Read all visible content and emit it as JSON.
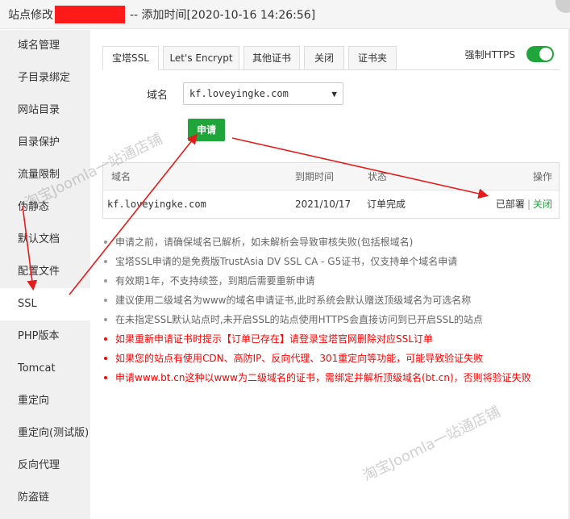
{
  "titlebar": {
    "prefix": "站点修改",
    "suffix": "-- 添加时间[2020-10-16 14:26:56]"
  },
  "sidebar": {
    "items": [
      {
        "label": "域名管理"
      },
      {
        "label": "子目录绑定"
      },
      {
        "label": "网站目录"
      },
      {
        "label": "目录保护"
      },
      {
        "label": "流量限制"
      },
      {
        "label": "伪静态"
      },
      {
        "label": "默认文档"
      },
      {
        "label": "配置文件"
      },
      {
        "label": "SSL"
      },
      {
        "label": "PHP版本"
      },
      {
        "label": "Tomcat"
      },
      {
        "label": "重定向"
      },
      {
        "label": "重定向(测试版)"
      },
      {
        "label": "反向代理"
      },
      {
        "label": "防盗链"
      }
    ]
  },
  "tabs": [
    {
      "label": "宝塔SSL"
    },
    {
      "label": "Let's Encrypt"
    },
    {
      "label": "其他证书"
    },
    {
      "label": "关闭"
    },
    {
      "label": "证书夹"
    }
  ],
  "force_https": {
    "label": "强制HTTPS",
    "enabled": true
  },
  "domain": {
    "label": "域名",
    "selected": "kf.loveyingke.com"
  },
  "apply_button": "申请",
  "table": {
    "headers": {
      "domain": "域名",
      "expire": "到期时间",
      "status": "状态",
      "action": "操作"
    },
    "rows": [
      {
        "domain": "kf.loveyingke.com",
        "expire": "2021/10/17",
        "status": "订单完成",
        "deployed": "已部署",
        "sep": "|",
        "close": "关闭"
      }
    ]
  },
  "notes": [
    "申请之前，请确保域名已解析，如未解析会导致审核失败(包括根域名)",
    "宝塔SSL申请的是免费版TrustAsia DV SSL CA - G5证书，仅支持单个域名申请",
    "有效期1年，不支持续签，到期后需要重新申请",
    "建议使用二级域名为www的域名申请证书,此时系统会默认赠送顶级域名为可选名称",
    "在未指定SSL默认站点时,未开启SSL的站点使用HTTPS会直接访问到已开启SSL的站点",
    "如果重新申请证书时提示【订单已存在】请登录宝塔官网删除对应SSL订单",
    "如果您的站点有使用CDN、高防IP、反向代理、301重定向等功能，可能导致验证失败",
    "申请www.bt.cn这种以www为二级域名的证书，需绑定并解析顶级域名(bt.cn)，否则将验证失败"
  ],
  "watermark": "淘宝Joomla一站通店铺",
  "colors": {
    "accent": "#20a53a",
    "warning": "#ff0000",
    "redact": "#ff1a1a"
  }
}
